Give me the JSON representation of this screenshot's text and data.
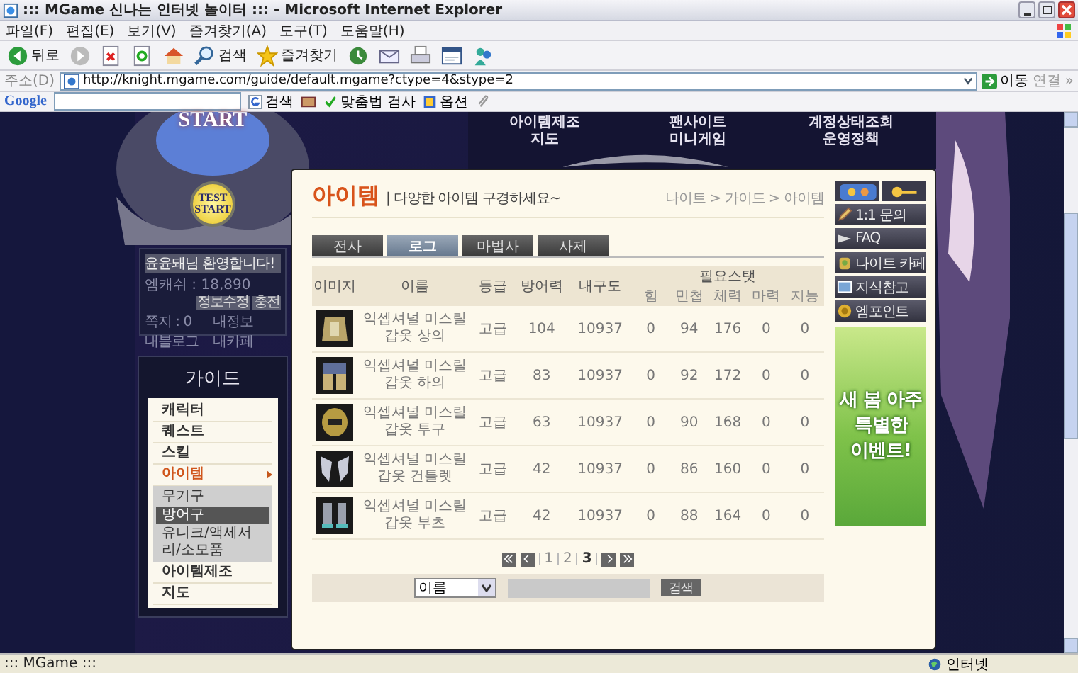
{
  "window": {
    "title": "::: MGame 신나는 인터넷 놀이터 ::: - Microsoft Internet Explorer"
  },
  "menu_bar": [
    "파일(F)",
    "편집(E)",
    "보기(V)",
    "즐겨찾기(A)",
    "도구(T)",
    "도움말(H)"
  ],
  "toolbar": [
    {
      "kind": "back",
      "label": "뒤로"
    },
    {
      "kind": "forward"
    },
    {
      "kind": "stop"
    },
    {
      "kind": "refresh"
    },
    {
      "kind": "home"
    },
    {
      "kind": "search",
      "label": "검색"
    },
    {
      "kind": "favorites",
      "label": "즐겨찾기"
    },
    {
      "kind": "history"
    },
    {
      "kind": "mail"
    },
    {
      "kind": "print"
    },
    {
      "kind": "edit"
    },
    {
      "kind": "messenger"
    }
  ],
  "address_bar": {
    "label": "주소(D)",
    "url": "http://knight.mgame.com/guide/default.mgame?ctype=4&stype=2",
    "go": "이동",
    "links": "연결",
    "more": "»"
  },
  "google_bar": {
    "logo": "Google",
    "search": "검색",
    "spell": "맞춤법 검사",
    "options": "옵션"
  },
  "site": {
    "top_nav": [
      {
        "items": [
          "아이템제조",
          "지도"
        ]
      },
      {
        "items": [
          "팬사이트",
          "미니게임"
        ]
      },
      {
        "items": [
          "계정상태조회",
          "운영정책"
        ]
      }
    ],
    "start_label": "START",
    "test_start": "TEST START",
    "login": {
      "greeting": "윤윤돼님 환영합니다!",
      "cash": "엠캐쉬 : 18,890",
      "buttons": [
        "정보수정",
        "충전"
      ],
      "links": [
        "쪽지 : 0",
        "내정보",
        "내블로그",
        "내카페"
      ]
    },
    "guide": {
      "title": "가이드",
      "items": [
        {
          "label": "캐릭터",
          "selected": false,
          "expanded": false
        },
        {
          "label": "퀘스트",
          "selected": false,
          "expanded": false
        },
        {
          "label": "스킬",
          "selected": false,
          "expanded": false
        },
        {
          "label": "아이템",
          "selected": true,
          "expanded": true,
          "children": [
            {
              "label": "무기구",
              "selected": false
            },
            {
              "label": "방어구",
              "selected": true
            },
            {
              "label": "유니크/액세서리/소모품",
              "selected": false
            }
          ]
        },
        {
          "label": "아이템제조",
          "selected": false,
          "expanded": false
        },
        {
          "label": "지도",
          "selected": false,
          "expanded": false
        }
      ]
    }
  },
  "page": {
    "title": "아이템",
    "subtitle": "| 다양한 아이템 구경하세요~",
    "breadcrumb": "나이트 > 가이드 > 아이템",
    "tabs": [
      {
        "label": "전사",
        "selected": false
      },
      {
        "label": "로그",
        "selected": true
      },
      {
        "label": "마법사",
        "selected": false
      },
      {
        "label": "사제",
        "selected": false
      }
    ],
    "table": {
      "columns": [
        "이미지",
        "이름",
        "등급",
        "방어력",
        "내구도"
      ],
      "stat_group": "필요스탯",
      "stat_columns": [
        "힘",
        "민첩",
        "체력",
        "마력",
        "지능"
      ],
      "rows": [
        {
          "name": "익셉셔널 미스릴 갑옷 상의",
          "grade": "고급",
          "defense": "104",
          "durability": "10937",
          "stats": [
            "0",
            "94",
            "176",
            "0",
            "0"
          ]
        },
        {
          "name": "익셉셔널 미스릴 갑옷 하의",
          "grade": "고급",
          "defense": "83",
          "durability": "10937",
          "stats": [
            "0",
            "92",
            "172",
            "0",
            "0"
          ]
        },
        {
          "name": "익셉셔널 미스릴 갑옷 투구",
          "grade": "고급",
          "defense": "63",
          "durability": "10937",
          "stats": [
            "0",
            "90",
            "168",
            "0",
            "0"
          ]
        },
        {
          "name": "익셉셔널 미스릴 갑옷 건틀렛",
          "grade": "고급",
          "defense": "42",
          "durability": "10937",
          "stats": [
            "0",
            "86",
            "160",
            "0",
            "0"
          ]
        },
        {
          "name": "익셉셔널 미스릴 갑옷 부츠",
          "grade": "고급",
          "defense": "42",
          "durability": "10937",
          "stats": [
            "0",
            "88",
            "164",
            "0",
            "0"
          ]
        }
      ]
    },
    "pagination": [
      {
        "label": "1",
        "selected": false
      },
      {
        "label": "2",
        "selected": false
      },
      {
        "label": "3",
        "selected": true
      }
    ],
    "search": {
      "select": "이름",
      "button": "검색"
    },
    "quick_links": [
      {
        "kind": "pencil",
        "label": "1:1 문의"
      },
      {
        "kind": "faq",
        "label": "FAQ"
      },
      {
        "kind": "cafe",
        "label": "나이트 카페"
      },
      {
        "kind": "book",
        "label": "지식참고"
      },
      {
        "kind": "coin",
        "label": "엠포인트"
      }
    ],
    "banner": {
      "lines": [
        "새 봄 아주",
        "특별한",
        "이벤트!"
      ]
    }
  },
  "status_bar": {
    "text": "::: MGame :::",
    "zone": "인터넷"
  }
}
